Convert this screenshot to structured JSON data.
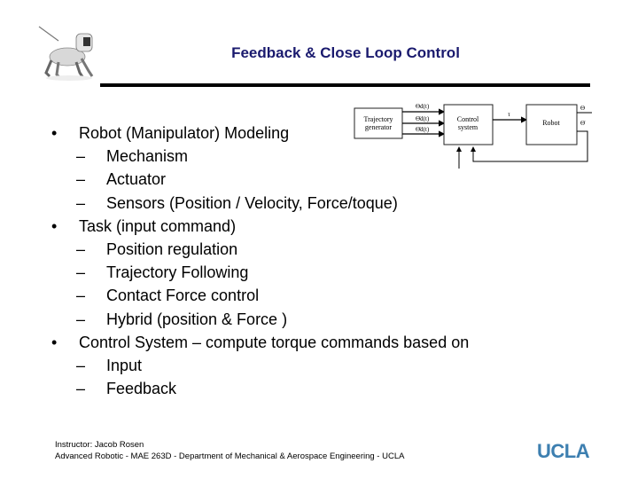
{
  "slide": {
    "title": "Feedback & Close Loop Control",
    "logo": "robot-dog-icon"
  },
  "diagram": {
    "blocks": {
      "trajectory_line1": "Trajectory",
      "trajectory_line2": "generator",
      "control_line1": "Control",
      "control_line2": "system",
      "robot": "Robot"
    },
    "signals": {
      "theta_d": "Θd(t)",
      "theta_d_dot": "Θ̇d(t)",
      "theta_d_ddot": "Θ̈d(t)",
      "tau": "τ",
      "theta_out": "Θ",
      "theta_dot_out": "Θ̇"
    }
  },
  "content": {
    "items": [
      {
        "level": 1,
        "marker": "•",
        "text": "Robot (Manipulator) Modeling"
      },
      {
        "level": 2,
        "marker": "–",
        "text": "Mechanism"
      },
      {
        "level": 2,
        "marker": "–",
        "text": "Actuator"
      },
      {
        "level": 2,
        "marker": "–",
        "text": "Sensors (Position / Velocity, Force/toque)"
      },
      {
        "level": 1,
        "marker": "•",
        "text": "Task (input command)"
      },
      {
        "level": 2,
        "marker": "–",
        "text": "Position regulation"
      },
      {
        "level": 2,
        "marker": "–",
        "text": "Trajectory Following"
      },
      {
        "level": 2,
        "marker": "–",
        "text": "Contact Force control"
      },
      {
        "level": 2,
        "marker": "–",
        "text": "Hybrid (position & Force )"
      },
      {
        "level": 1,
        "marker": "•",
        "text": "Control System – compute torque commands based on"
      },
      {
        "level": 2,
        "marker": "–",
        "text": "Input"
      },
      {
        "level": 2,
        "marker": "–",
        "text": "Feedback"
      }
    ]
  },
  "footer": {
    "line1": "Instructor: Jacob Rosen",
    "line2": "Advanced Robotic - MAE 263D - Department of Mechanical & Aerospace Engineering - UCLA",
    "logo_text": "UCLA"
  },
  "colors": {
    "title": "#1a1a6e",
    "ucla": "#3d7fb0"
  }
}
